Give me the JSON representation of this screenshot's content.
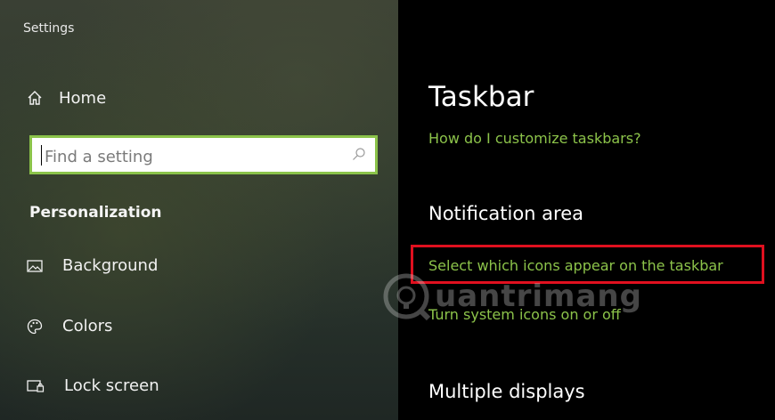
{
  "window": {
    "title": "Settings"
  },
  "sidebar": {
    "home_label": "Home",
    "search_placeholder": "Find a setting",
    "section_title": "Personalization",
    "items": [
      {
        "label": "Background",
        "icon": "image-icon"
      },
      {
        "label": "Colors",
        "icon": "palette-icon"
      },
      {
        "label": "Lock screen",
        "icon": "lock-screen-icon"
      }
    ]
  },
  "main": {
    "title": "Taskbar",
    "help_link": "How do I customize taskbars?",
    "notification_heading": "Notification area",
    "select_icons_link": "Select which icons appear on the taskbar",
    "system_icons_link": "Turn system icons on or off",
    "multiple_displays_heading": "Multiple displays"
  },
  "watermark": {
    "text": "uantrimang"
  },
  "colors": {
    "accent": "#8cc34a",
    "highlight": "#e0101f",
    "search_border": "#8bc34a"
  }
}
